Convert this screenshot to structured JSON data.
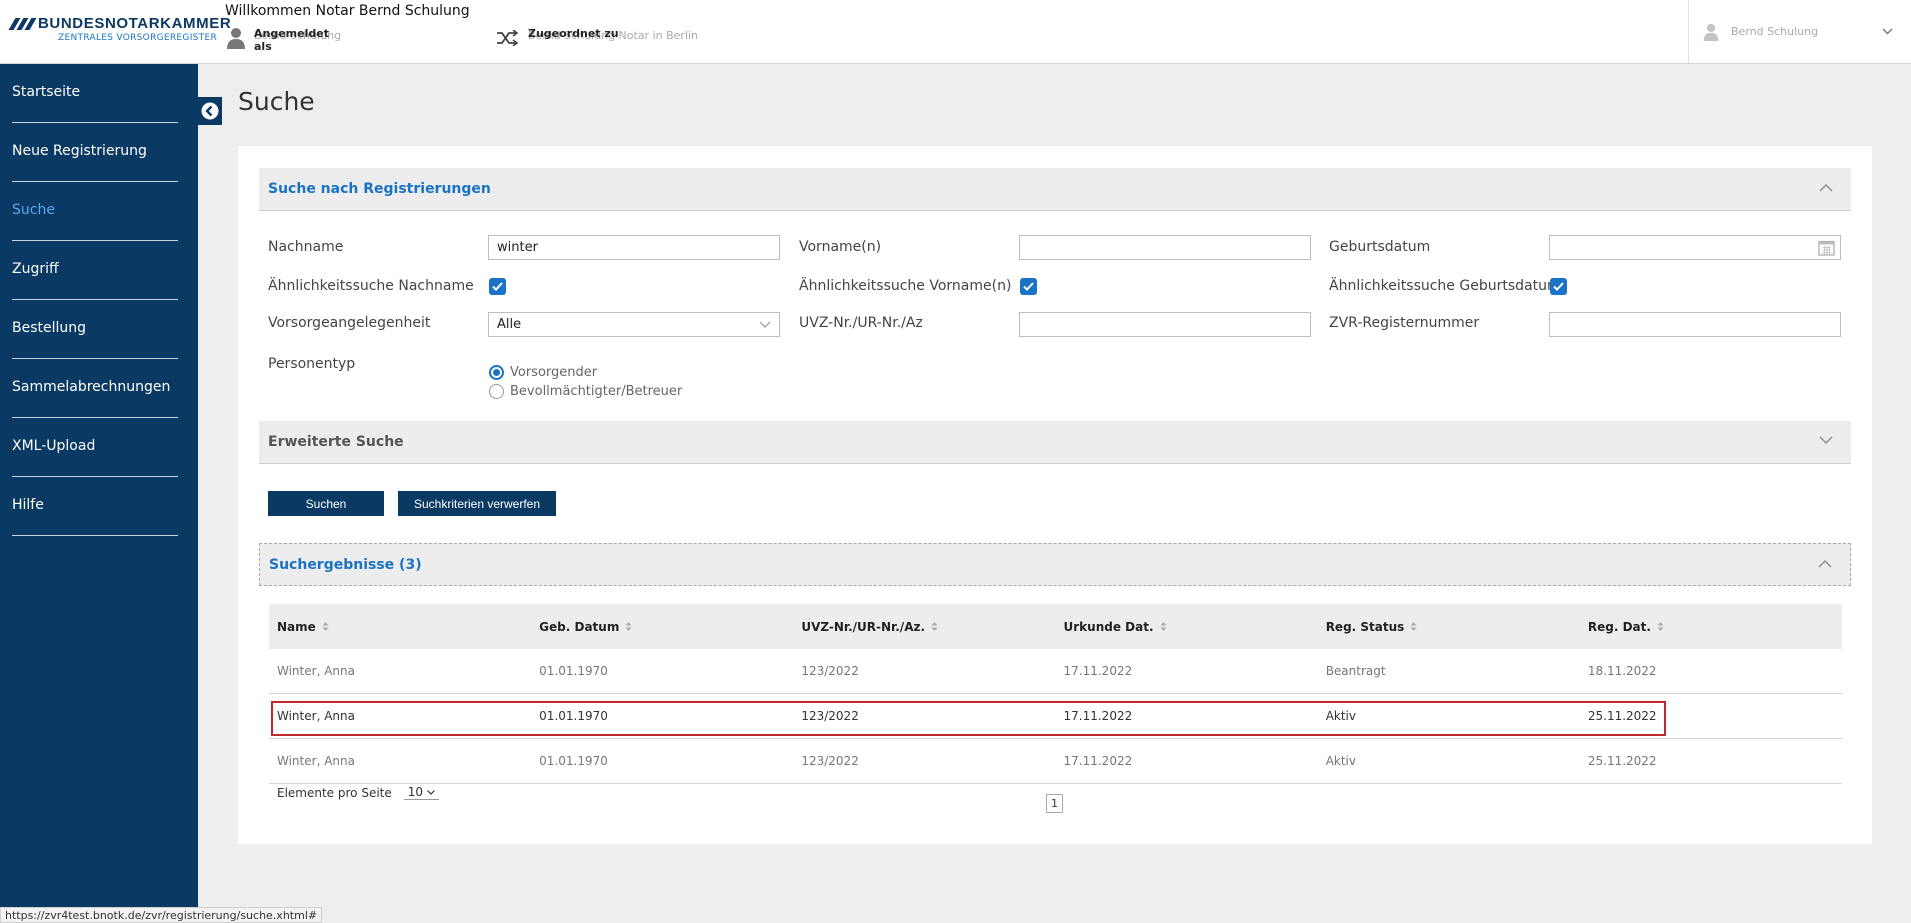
{
  "header": {
    "brand": "BUNDESNOTARKAMMER",
    "brand_sub": "ZENTRALES VORSORGEREGISTER",
    "welcome": "Willkommen Notar Bernd Schulung",
    "logged_in_label": "Angemeldet als",
    "logged_in_value": "Bernd Schulung",
    "assigned_label": "Zugeordnet zu",
    "assigned_value": "Bernd Schulung Notar in Berlin",
    "user_name": "Bernd Schulung"
  },
  "sidebar": {
    "items": [
      {
        "label": "Startseite"
      },
      {
        "label": "Neue Registrierung"
      },
      {
        "label": "Suche"
      },
      {
        "label": "Zugriff"
      },
      {
        "label": "Bestellung"
      },
      {
        "label": "Sammelabrechnungen"
      },
      {
        "label": "XML-Upload"
      },
      {
        "label": "Hilfe"
      }
    ],
    "active": "Suche"
  },
  "page": {
    "title": "Suche"
  },
  "search": {
    "section_title": "Suche nach Registrierungen",
    "nachname_label": "Nachname",
    "nachname_value": "winter",
    "vorname_label": "Vorname(n)",
    "vorname_value": "",
    "geburtsdatum_label": "Geburtsdatum",
    "geburtsdatum_value": "",
    "sim_nachname_label": "Ähnlichkeitssuche Nachname",
    "sim_nachname_checked": true,
    "sim_vorname_label": "Ähnlichkeitssuche Vorname(n)",
    "sim_vorname_checked": true,
    "sim_geburtsdatum_label": "Ähnlichkeitssuche Geburtsdatum",
    "sim_geburtsdatum_checked": true,
    "vorsorge_label": "Vorsorgeangelegenheit",
    "vorsorge_value": "Alle",
    "uvz_label": "UVZ-Nr./UR-Nr./Az",
    "uvz_value": "",
    "zvr_label": "ZVR-Registernummer",
    "zvr_value": "",
    "personentyp_label": "Personentyp",
    "personentyp_options": [
      "Vorsorgender",
      "Bevollmächtigter/Betreuer"
    ],
    "personentyp_selected": "Vorsorgender"
  },
  "extended": {
    "title": "Erweiterte Suche"
  },
  "buttons": {
    "search": "Suchen",
    "reset": "Suchkriterien verwerfen"
  },
  "results": {
    "title": "Suchergebnisse (3)",
    "columns": [
      "Name",
      "Geb. Datum",
      "UVZ-Nr./UR-Nr./Az.",
      "Urkunde Dat.",
      "Reg. Status",
      "Reg. Dat."
    ],
    "rows": [
      [
        "Winter, Anna",
        "01.01.1970",
        "123/2022",
        "17.11.2022",
        "Beantragt",
        "18.11.2022"
      ],
      [
        "Winter, Anna",
        "01.01.1970",
        "123/2022",
        "17.11.2022",
        "Aktiv",
        "25.11.2022"
      ],
      [
        "Winter, Anna",
        "01.01.1970",
        "123/2022",
        "17.11.2022",
        "Aktiv",
        "25.11.2022"
      ]
    ],
    "highlighted_row": 1,
    "per_page_label": "Elemente pro Seite",
    "per_page_value": "10",
    "current_page": "1"
  },
  "status_url": "https://zvr4test.bnotk.de/zvr/registrierung/suche.xhtml#",
  "colors": {
    "navy": "#0a3a63",
    "accent": "#1a73c4",
    "highlight": "#c0282d"
  }
}
